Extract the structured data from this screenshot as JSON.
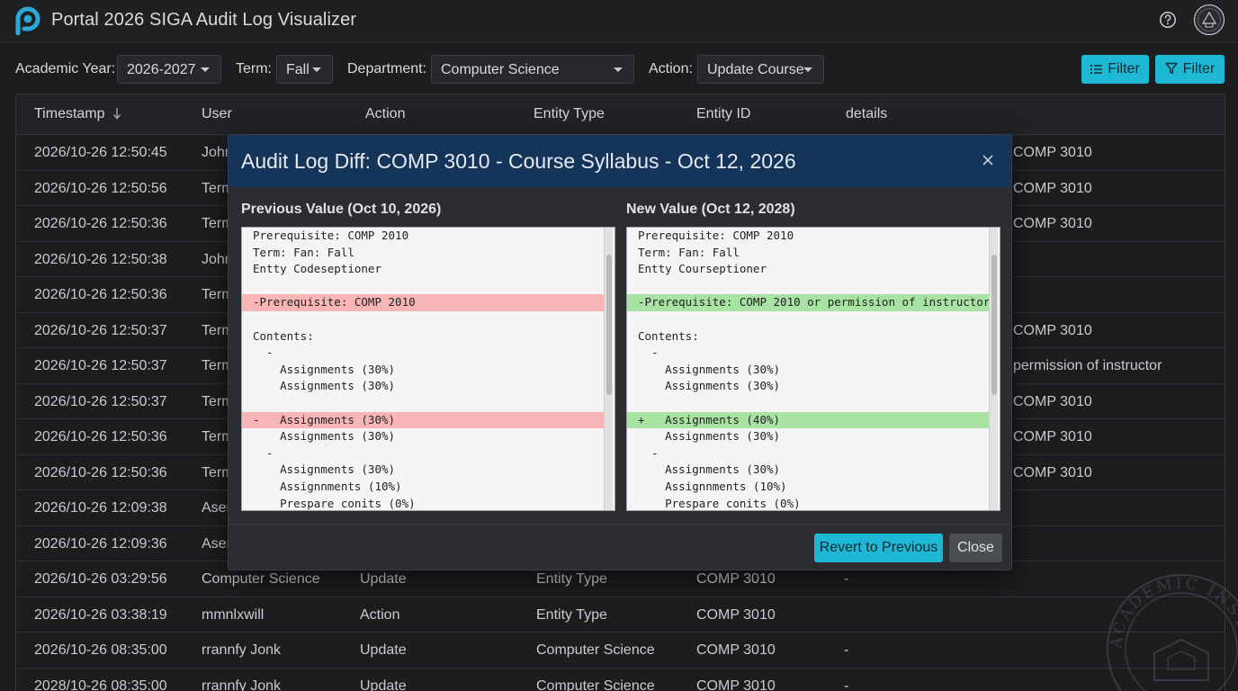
{
  "app": {
    "title": "Portal 2026 SIGA Audit Log Visualizer",
    "logo_icon": "portal-p-logo",
    "help_icon": "help-circle-icon",
    "seal_icon": "institution-seal-icon"
  },
  "filters": {
    "academic_year_label": "Academic Year:",
    "academic_year_value": "2026-2027",
    "term_label": "Term:",
    "term_value": "Fall",
    "department_label": "Department:",
    "department_value": "Computer Science",
    "action_label": "Action:",
    "action_value": "Update Course",
    "filter_button_1": "Filter",
    "filter_button_2": "Filter"
  },
  "table": {
    "headers": {
      "timestamp": "Timestamp",
      "user": "User",
      "action": "Action",
      "entity_type": "Entity Type",
      "entity_id": "Entity ID",
      "details": "details"
    },
    "rows": [
      {
        "ts": "2026/10-26 12:50:45",
        "user": "John",
        "action": "",
        "type": "",
        "id": "",
        "details": "COMP 3010"
      },
      {
        "ts": "2026/10-26 12:50:56",
        "user": "Term",
        "action": "",
        "type": "",
        "id": "",
        "details": "COMP 3010"
      },
      {
        "ts": "2026/10-26 12:50:36",
        "user": "Term",
        "action": "",
        "type": "",
        "id": "",
        "details": "COMP 3010"
      },
      {
        "ts": "2026/10-26 12:50:38",
        "user": "John",
        "action": "",
        "type": "",
        "id": "",
        "details": ""
      },
      {
        "ts": "2026/10-26 12:50:36",
        "user": "Term",
        "action": "",
        "type": "",
        "id": "",
        "details": ""
      },
      {
        "ts": "2026/10-26 12:50:37",
        "user": "Term",
        "action": "",
        "type": "",
        "id": "",
        "details": "COMP 3010"
      },
      {
        "ts": "2026/10-26 12:50:37",
        "user": "Term",
        "action": "",
        "type": "",
        "id": "",
        "details": "permission of instructor"
      },
      {
        "ts": "2026/10-26 12:50:37",
        "user": "Term",
        "action": "",
        "type": "",
        "id": "",
        "details": "COMP 3010"
      },
      {
        "ts": "2026/10-26 12:50:36",
        "user": "Term",
        "action": "",
        "type": "",
        "id": "",
        "details": "COMP 3010"
      },
      {
        "ts": "2026/10-26 12:50:36",
        "user": "Term",
        "action": "",
        "type": "",
        "id": "",
        "details": "COMP 3010"
      },
      {
        "ts": "2026/10-26 12:09:38",
        "user": "Asen",
        "action": "",
        "type": "",
        "id": "",
        "details": ""
      },
      {
        "ts": "2026/10-26 12:09:36",
        "user": "Asen",
        "action": "",
        "type": "",
        "id": "",
        "details": ""
      },
      {
        "ts": "2026/10-26 03:29:56",
        "user": "Computer Science",
        "action": "Update",
        "type": "Entity Type",
        "id": "COMP 3010",
        "details": "-"
      },
      {
        "ts": "2026/10-26 03:38:19",
        "user": "mmnlxwill",
        "action": "Action",
        "type": "Entity Type",
        "id": "COMP 3010",
        "details": ""
      },
      {
        "ts": "2026/10-26 08:35:00",
        "user": "rrannfy Jonk",
        "action": "Update",
        "type": "Computer Science",
        "id": "COMP 3010",
        "details": "-"
      },
      {
        "ts": "2028/10-26 08:35:00",
        "user": "rrannfy Jonk",
        "action": "Update",
        "type": "Computer Science",
        "id": "COMP 3010",
        "details": "-"
      }
    ]
  },
  "modal": {
    "title": "Audit Log Diff: COMP 3010 - Course Syllabus - Oct 12, 2026",
    "previous_title": "Previous Value (Oct 10, 2026)",
    "new_title": "New Value (Oct 12, 2028)",
    "previous_lines": [
      {
        "kind": "normal",
        "text": "Prerequisite: COMP 2010"
      },
      {
        "kind": "normal",
        "text": "Term: Fan: Fall"
      },
      {
        "kind": "normal",
        "text": "Entty Codeseptioner"
      },
      {
        "kind": "normal",
        "text": ""
      },
      {
        "kind": "del",
        "text": "-Prerequisite: COMP 2010"
      },
      {
        "kind": "normal",
        "text": ""
      },
      {
        "kind": "normal",
        "text": "Contents:"
      },
      {
        "kind": "normal",
        "text": "  -"
      },
      {
        "kind": "normal",
        "text": "    Assignments (30%)"
      },
      {
        "kind": "normal",
        "text": "    Assignments (30%)"
      },
      {
        "kind": "normal",
        "text": ""
      },
      {
        "kind": "del",
        "text": "-   Assignments (30%)"
      },
      {
        "kind": "normal",
        "text": "    Assignments (30%)"
      },
      {
        "kind": "normal",
        "text": "  -"
      },
      {
        "kind": "normal",
        "text": "    Assignments (30%)"
      },
      {
        "kind": "normal",
        "text": "    Assignnments (10%)"
      },
      {
        "kind": "normal",
        "text": "    Prespare conits (0%)"
      }
    ],
    "new_lines": [
      {
        "kind": "normal",
        "text": "Prerequisite: COMP 2010"
      },
      {
        "kind": "normal",
        "text": "Term: Fan: Fall"
      },
      {
        "kind": "normal",
        "text": "Entty Courseptioner"
      },
      {
        "kind": "normal",
        "text": ""
      },
      {
        "kind": "add",
        "text": "-Prerequisite: COMP 2010 or permission of instructor"
      },
      {
        "kind": "normal",
        "text": ""
      },
      {
        "kind": "normal",
        "text": "Contents:"
      },
      {
        "kind": "normal",
        "text": "  -"
      },
      {
        "kind": "normal",
        "text": "    Assignments (30%)"
      },
      {
        "kind": "normal",
        "text": "    Assignments (30%)"
      },
      {
        "kind": "normal",
        "text": ""
      },
      {
        "kind": "add",
        "text": "+   Assignments (40%)"
      },
      {
        "kind": "normal",
        "text": "    Assignments (30%)"
      },
      {
        "kind": "normal",
        "text": "  -"
      },
      {
        "kind": "normal",
        "text": "    Assignments (30%)"
      },
      {
        "kind": "normal",
        "text": "    Assignnments (10%)"
      },
      {
        "kind": "normal",
        "text": "    Prespare conits (0%)"
      }
    ],
    "revert_label": "Revert to Previous",
    "close_label": "Close",
    "close_icon": "close-x-icon"
  },
  "watermark": {
    "text": "ACADEMIC INSTITUTE",
    "icon": "academic-seal-watermark"
  },
  "colors": {
    "accent": "#1fb8d4",
    "modal_header": "#15345a",
    "deleted_line": "#f7b5b5",
    "added_line": "#a8e3a3"
  }
}
